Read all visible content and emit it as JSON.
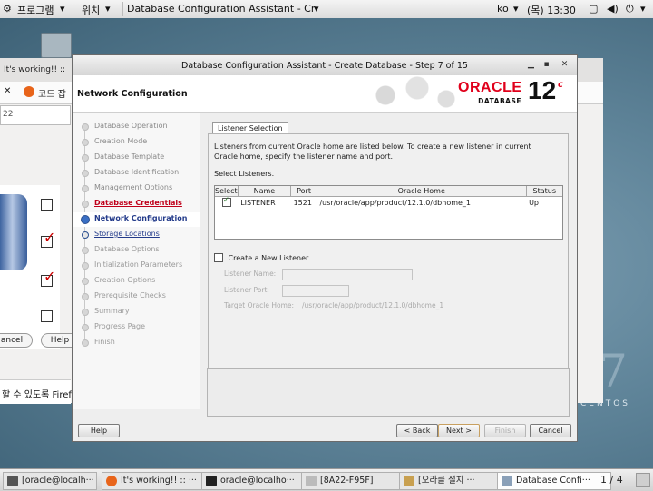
{
  "top_panel": {
    "applications": "프로그램",
    "places": "위치",
    "active_window": "Database Configuration Assistant - Cr···",
    "input_method": "ko",
    "clock": "(목) 13:30"
  },
  "background_window": {
    "tab1": "It's working!! ::",
    "tab2": "코드 잡",
    "url": "22",
    "cancel_btn": "ancel",
    "help_btn": "Help",
    "firefox_text": "할 수 있도록 Firef"
  },
  "dialog": {
    "title": "Database Configuration Assistant - Create Database - Step 7 of 15",
    "step_title": "Network Configuration",
    "brand": "ORACLE",
    "brand_sub": "DATABASE",
    "version": "12",
    "version_suffix": "c",
    "nav": [
      {
        "label": "Database Operation",
        "state": "done"
      },
      {
        "label": "Creation Mode",
        "state": "done"
      },
      {
        "label": "Database Template",
        "state": "done"
      },
      {
        "label": "Database Identification",
        "state": "done"
      },
      {
        "label": "Management Options",
        "state": "done"
      },
      {
        "label": "Database Credentials",
        "state": "warn"
      },
      {
        "label": "Network Configuration",
        "state": "current"
      },
      {
        "label": "Storage Locations",
        "state": "link"
      },
      {
        "label": "Database Options",
        "state": "todo"
      },
      {
        "label": "Initialization Parameters",
        "state": "todo"
      },
      {
        "label": "Creation Options",
        "state": "todo"
      },
      {
        "label": "Prerequisite Checks",
        "state": "todo"
      },
      {
        "label": "Summary",
        "state": "todo"
      },
      {
        "label": "Progress Page",
        "state": "todo"
      },
      {
        "label": "Finish",
        "state": "todo"
      }
    ],
    "tab": "Listener Selection",
    "description": "Listeners from current Oracle home are listed below. To create a new listener in current Oracle home, specify the listener name and port.",
    "select_label": "Select Listeners.",
    "table": {
      "headers": [
        "Select",
        "Name",
        "Port",
        "Oracle Home",
        "Status"
      ],
      "rows": [
        {
          "selected": true,
          "name": "LISTENER",
          "port": "1521",
          "home": "/usr/oracle/app/product/12.1.0/dbhome_1",
          "status": "Up"
        }
      ]
    },
    "new_listener_label": "Create a New Listener",
    "listener_name_label": "Listener Name:",
    "listener_port_label": "Listener Port:",
    "target_home_label": "Target Oracle Home:",
    "target_home_value": "/usr/oracle/app/product/12.1.0/dbhome_1",
    "buttons": {
      "help": "Help",
      "back": "< Back",
      "next": "Next >",
      "finish": "Finish",
      "cancel": "Cancel"
    }
  },
  "taskbar": {
    "items": [
      "[oracle@localh···",
      "It's working!! :: ···",
      "oracle@localho···",
      "[8A22-F95F]",
      "[오라클 설치 ···",
      "Database Confi···"
    ],
    "pager": "1 / 4"
  },
  "desktop": {
    "brand": "CENTOS",
    "version": "7"
  }
}
